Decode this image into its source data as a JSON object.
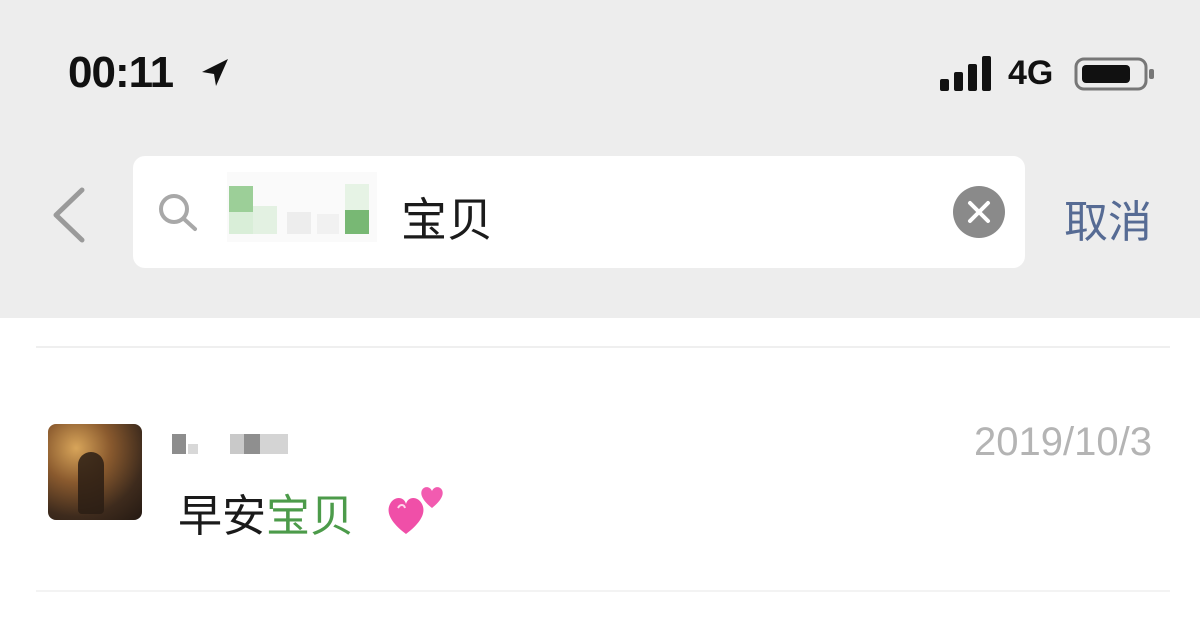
{
  "status_bar": {
    "time": "00:11",
    "network": "4G",
    "icons": [
      "location-arrow-icon",
      "signal-icon",
      "battery-icon"
    ]
  },
  "search": {
    "value": "宝贝",
    "cancel_label": "取消",
    "icons": [
      "back-chevron-icon",
      "search-icon",
      "clear-icon"
    ]
  },
  "results": [
    {
      "date": "2019/10/3",
      "message_prefix": "早安",
      "message_highlight": "宝贝",
      "emoji_icon": "two-hearts-icon"
    }
  ],
  "colors": {
    "top_background": "#ededed",
    "highlight": "#4c9b4a",
    "cancel": "#566b94",
    "date": "#b4b4b4"
  }
}
